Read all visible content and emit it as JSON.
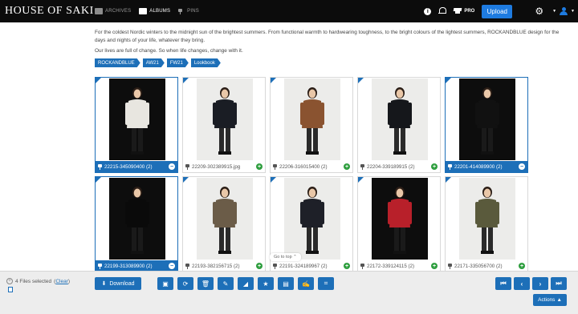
{
  "header": {
    "logo": "HOUSE OF SAKI",
    "nav": [
      {
        "label": "ARCHIVES",
        "icon": "folder-icon"
      },
      {
        "label": "ALBUMS",
        "icon": "album-icon"
      },
      {
        "label": "PINS",
        "icon": "pin-icon"
      }
    ],
    "pro_label": "PRO",
    "upload_label": "Upload"
  },
  "album": {
    "description": "For the coldest Nordic winters to the midnight sun of the brightest summers. From functional warmth to hardwearing toughness, to the bright colours of the lightest summers, ROCKANDBLUE design for the days and nights of your life, whatever they bring.",
    "tagline": "Our lives are full of change. So when life changes, change with it.",
    "tags": [
      "ROCKANDBLUE",
      "AW21",
      "FW21",
      "Lookbook"
    ]
  },
  "files": [
    {
      "name": "22215-345090400 (2)",
      "selected": true,
      "bg": "dark",
      "coat": "#e8e6e0"
    },
    {
      "name": "22209-302389915.jpg",
      "selected": false,
      "bg": "light",
      "coat": "#1a1d24"
    },
    {
      "name": "22206-316015400 (2)",
      "selected": false,
      "bg": "light",
      "coat": "#8a5330"
    },
    {
      "name": "22204-339189915 (2)",
      "selected": false,
      "bg": "light",
      "coat": "#15171b"
    },
    {
      "name": "22201-414089900 (2)",
      "selected": true,
      "bg": "dark",
      "coat": "#111111"
    },
    {
      "name": "22199-313089900 (2)",
      "selected": true,
      "bg": "dark",
      "coat": "#0a0a0a"
    },
    {
      "name": "22193-382156715 (2)",
      "selected": false,
      "bg": "light",
      "coat": "#6b5c48"
    },
    {
      "name": "22191-324189967 (2)",
      "selected": false,
      "bg": "light",
      "coat": "#1e2028"
    },
    {
      "name": "22172-339124115 (2)",
      "selected": false,
      "bg": "dark",
      "coat": "#b8202a"
    },
    {
      "name": "22171-335056700 (2)",
      "selected": false,
      "bg": "light",
      "coat": "#5a5a3c"
    }
  ],
  "goto_top": "Go to top",
  "footer": {
    "selected_text": "4 Files selected",
    "clear_label": "Clear",
    "download_label": "Download",
    "actions_label": "Actions",
    "tools": [
      "briefcase-icon",
      "crop-rotate-icon",
      "trash-icon",
      "pencil-icon",
      "signal-icon",
      "star-icon",
      "document-icon",
      "edit-icon",
      "crop-icon"
    ],
    "pager": [
      "first-page-icon",
      "prev-page-icon",
      "next-page-icon",
      "last-page-icon"
    ]
  },
  "colors": {
    "accent": "#1d6fb8",
    "topbar": "#0c0c0c",
    "add": "#2e9e3e"
  }
}
